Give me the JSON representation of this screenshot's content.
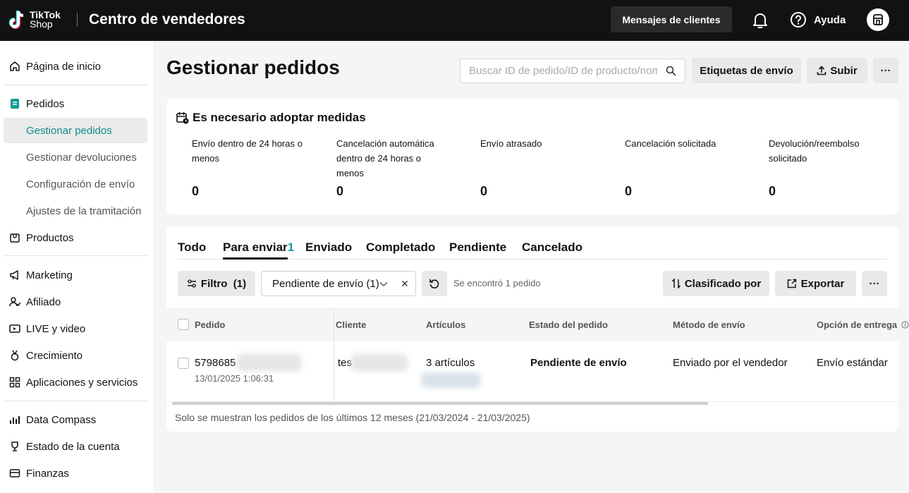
{
  "topbar": {
    "logo_line1": "TikTok",
    "logo_line2": "Shop",
    "app_title": "Centro de vendedores",
    "messages_button": "Mensajes de clientes",
    "help_label": "Ayuda"
  },
  "sidebar": {
    "home": "Página de inicio",
    "orders": "Pedidos",
    "orders_sub": [
      "Gestionar pedidos",
      "Gestionar devoluciones",
      "Configuración de envío",
      "Ajustes de la tramitación"
    ],
    "products": "Productos",
    "marketing": "Marketing",
    "affiliate": "Afiliado",
    "live_video": "LIVE y video",
    "growth": "Crecimiento",
    "apps_services": "Aplicaciones y servicios",
    "data_compass": "Data Compass",
    "account_status": "Estado de la cuenta",
    "finance": "Finanzas"
  },
  "header": {
    "title": "Gestionar pedidos",
    "search_placeholder": "Buscar ID de pedido/ID de producto/nombre",
    "shipping_labels_button": "Etiquetas de envío",
    "upload_button": "Subir",
    "more_button": "···"
  },
  "action_needed": {
    "title": "Es necesario adoptar medidas",
    "metrics": [
      {
        "label": "Envío dentro de 24 horas o menos",
        "value": "0"
      },
      {
        "label": "Cancelación automática dentro de 24 horas o menos",
        "value": "0"
      },
      {
        "label": "Envío atrasado",
        "value": "0"
      },
      {
        "label": "Cancelación solicitada",
        "value": "0"
      },
      {
        "label": "Devolución/reembolso solicitado",
        "value": "0"
      }
    ]
  },
  "tabs": {
    "all": "Todo",
    "to_ship": "Para enviar",
    "to_ship_count": "1",
    "shipped": "Enviado",
    "completed": "Completado",
    "pending": "Pendiente",
    "cancelled": "Cancelado"
  },
  "filters": {
    "filter_button": "Filtro",
    "filter_count": "(1)",
    "status_select": "Pendiente de envío (1)",
    "found_text": "Se encontró 1 pedido",
    "sort_button": "Clasificado por",
    "export_button": "Exportar",
    "more_button": "···"
  },
  "table": {
    "headers": [
      "Pedido",
      "Cliente",
      "Artículos",
      "Estado del pedido",
      "Método de envío",
      "Opción de entrega"
    ],
    "rows": [
      {
        "order_id": "5798685",
        "order_date": "13/01/2025 1:06:31",
        "customer": "tes",
        "items": "3 artículos",
        "status": "Pendiente de envío",
        "shipping_method": "Enviado por el vendedor",
        "delivery_option": "Envío estándar"
      }
    ]
  },
  "footnote": "Solo se muestran los pedidos de los últimos 12 meses (21/03/2024 - 21/03/2025)",
  "colors": {
    "accent": "#129c96",
    "topbar": "#121212"
  }
}
